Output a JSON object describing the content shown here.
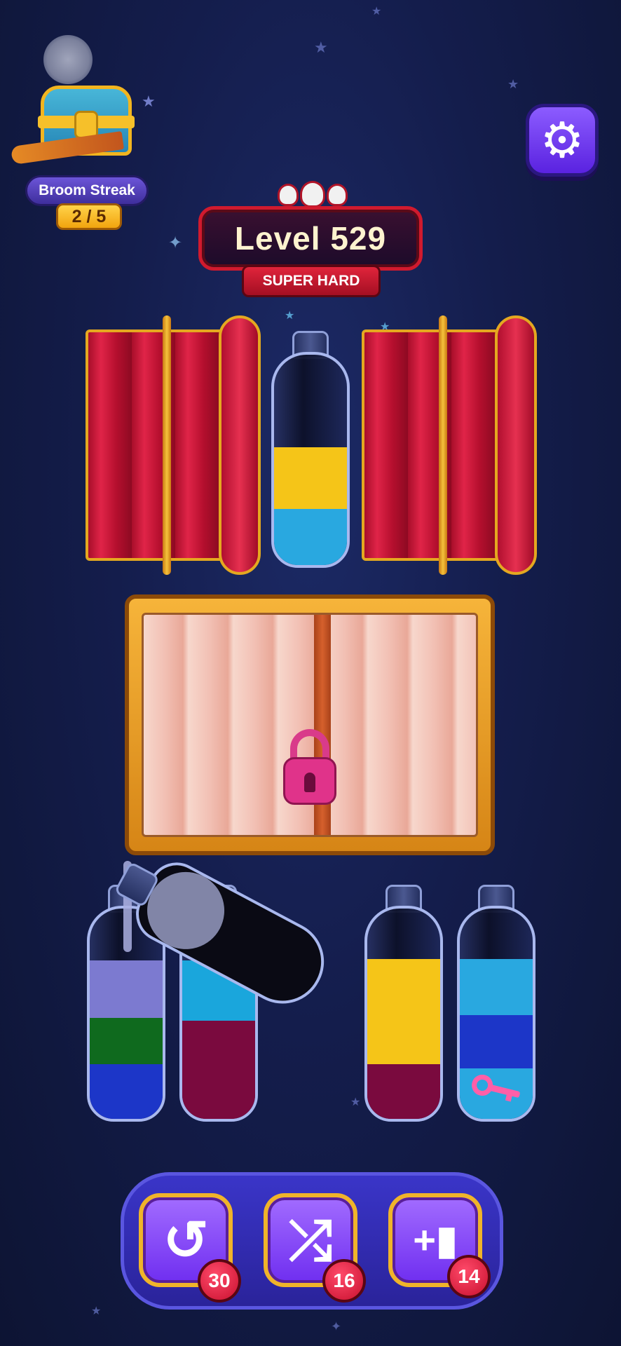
{
  "streak": {
    "label": "Broom Streak",
    "progress": "2 / 5"
  },
  "level": {
    "title": "Level 529",
    "difficulty": "SUPER HARD",
    "skull_count": 3
  },
  "bottles": [
    {
      "id": "top-center",
      "layers_bottom_to_top": [
        "#29a8e0",
        "#f5c518"
      ]
    },
    {
      "id": "bottom-1",
      "layers_bottom_to_top": [
        "#1c36c8",
        "#0f6a1e",
        "#7c7ad0"
      ]
    },
    {
      "id": "bottom-2",
      "layers_bottom_to_top": [
        "#7a0a3e",
        "#7a0a3e",
        "#1aa6dc"
      ]
    },
    {
      "id": "bottom-3",
      "layers_bottom_to_top": [
        "#7a0a3e",
        "#f5c518",
        "#f5c518"
      ]
    },
    {
      "id": "bottom-4",
      "layers_bottom_to_top": [
        "#29a8e0",
        "#1c36c8",
        "#29a8e0"
      ],
      "item": "key-icon"
    }
  ],
  "pouring_bottle": {
    "liquid": "#0a0a14"
  },
  "locked_crate": {
    "lock_color": "#e0338a"
  },
  "toolbar": {
    "undo": {
      "icon": "undo-icon",
      "count": "30"
    },
    "shuffle": {
      "icon": "shuffle-icon",
      "count": "16"
    },
    "add_bottle": {
      "icon": "add-bottle-icon",
      "count": "14"
    }
  },
  "colors": {
    "background": "#141d4c",
    "accent_purple": "#6f2ef0",
    "banner_red": "#d01a2e",
    "gold": "#f0b42a"
  }
}
